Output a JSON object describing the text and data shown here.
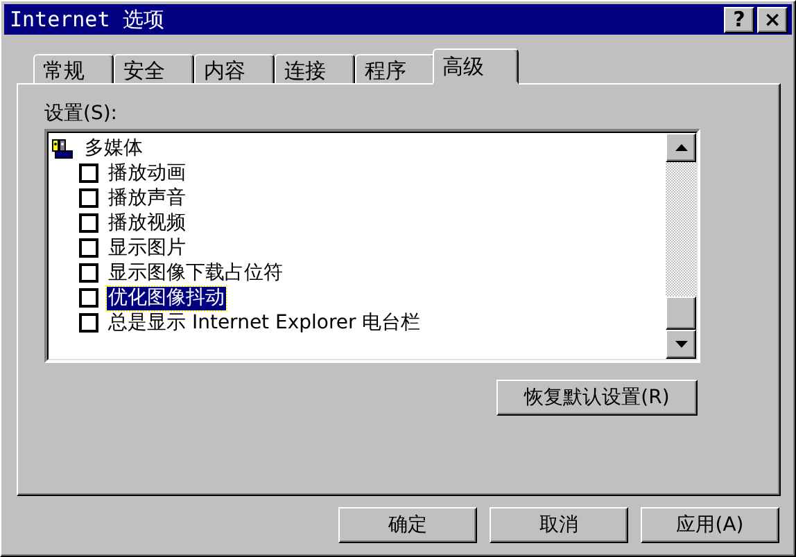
{
  "window": {
    "title": "Internet 选项",
    "title_buttons": [
      "?",
      "×"
    ]
  },
  "tabs": [
    {
      "label": "常规",
      "selected": false
    },
    {
      "label": "安全",
      "selected": false
    },
    {
      "label": "内容",
      "selected": false
    },
    {
      "label": "连接",
      "selected": false
    },
    {
      "label": "程序",
      "selected": false
    },
    {
      "label": "高级",
      "selected": true
    }
  ],
  "settings": {
    "label": "设置(S):",
    "tree": [
      {
        "label": "多媒体",
        "children": [
          {
            "label": "播放动画",
            "checked": false,
            "selected": false
          },
          {
            "label": "播放声音",
            "checked": false,
            "selected": false
          },
          {
            "label": "播放视频",
            "checked": false,
            "selected": false
          },
          {
            "label": "显示图片",
            "checked": false,
            "selected": false
          },
          {
            "label": "显示图像下载占位符",
            "checked": false,
            "selected": false
          },
          {
            "label": "优化图像抖动",
            "checked": false,
            "selected": true
          },
          {
            "label": "总是显示 Internet Explorer 电台栏",
            "checked": false,
            "selected": false
          }
        ]
      }
    ]
  },
  "restore_button": "恢复默认设置(R)",
  "buttons": [
    "确定",
    "取消",
    "应用(A)"
  ]
}
